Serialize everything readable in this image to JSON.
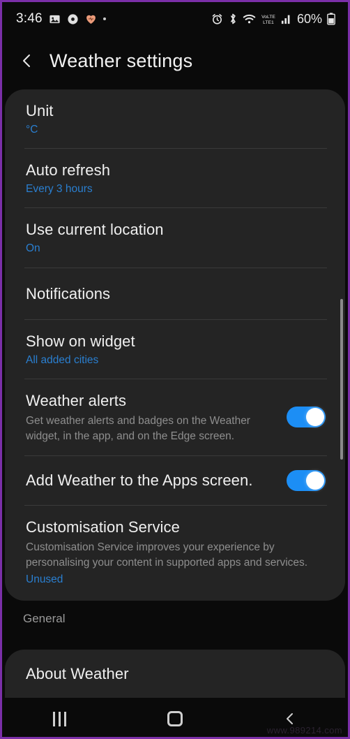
{
  "status_bar": {
    "time": "3:46",
    "left_icons": [
      "image-icon",
      "record-icon",
      "heart-icon",
      "dot-icon"
    ],
    "right_icons": [
      "alarm-icon",
      "bluetooth-icon",
      "wifi-icon",
      "volte-lte-icon",
      "signal-icon"
    ],
    "network_label": "VoLTE1",
    "battery_percent": "60%"
  },
  "app_bar": {
    "back_label": "back-arrow",
    "title": "Weather settings"
  },
  "settings": [
    {
      "title": "Unit",
      "value": "°C",
      "type": "value"
    },
    {
      "title": "Auto refresh",
      "value": "Every 3 hours",
      "type": "value"
    },
    {
      "title": "Use current location",
      "value": "On",
      "type": "value"
    },
    {
      "title": "Notifications",
      "value": "",
      "type": "plain"
    },
    {
      "title": "Show on widget",
      "value": "All added cities",
      "type": "value"
    },
    {
      "title": "Weather alerts",
      "description": "Get weather alerts and badges on the Weather widget, in the app, and on the Edge screen.",
      "type": "switch",
      "switch_on": true
    },
    {
      "title": "Add Weather to the Apps screen.",
      "type": "switch",
      "switch_on": true
    },
    {
      "title": "Customisation Service",
      "description": "Customisation Service improves your experience by personalising your content in supported apps and services.",
      "value": "Unused",
      "type": "description-value"
    }
  ],
  "general": {
    "section_label": "General",
    "items": [
      {
        "title": "About Weather"
      }
    ]
  },
  "nav_bar": {
    "recents_label": "recents-button",
    "home_label": "home-button",
    "back_label": "back-button"
  },
  "watermark": "www.989214.com",
  "colors": {
    "accent_blue": "#2a7fd0",
    "switch_on": "#1c8ef5",
    "card_bg": "#242424",
    "page_bg": "#0a0a0a",
    "frame": "#7b2fa8"
  }
}
